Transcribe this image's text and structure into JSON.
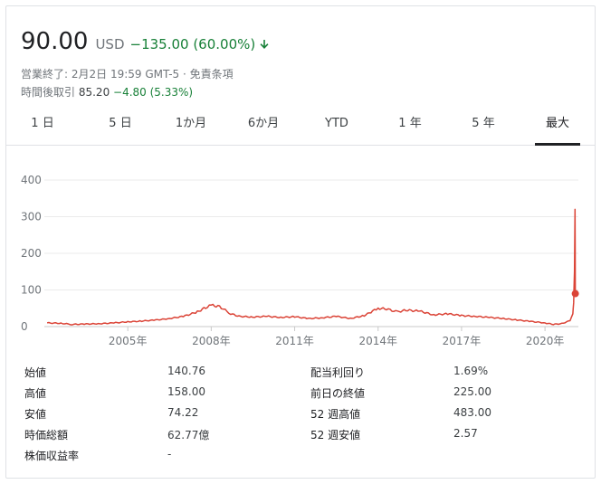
{
  "quote": {
    "price": "90.00",
    "currency": "USD",
    "change": "−135.00 (60.00%)",
    "status_line": "営業終了: 2月2日 19:59 GMT-5 · 免責条項",
    "after_hours_label": "時間後取引",
    "after_hours_price": "85.20",
    "after_hours_change": "−4.80 (5.33%)"
  },
  "tabs": [
    "1 日",
    "5 日",
    "1か月",
    "6か月",
    "YTD",
    "1 年",
    "5 年",
    "最大"
  ],
  "active_tab": "最大",
  "colors": {
    "line": "#db4437",
    "positive": "#188038",
    "grid": "#ebebeb"
  },
  "icons": {
    "change_arrow": "arrow-down-icon"
  },
  "chart_data": {
    "type": "line",
    "ylim": [
      0,
      400
    ],
    "yticks": [
      "0",
      "100",
      "200",
      "300",
      "400"
    ],
    "xticks": [
      "2005年",
      "2008年",
      "2011年",
      "2014年",
      "2017年",
      "2020年"
    ],
    "series": [
      {
        "x": [
          2002.1,
          2002.6,
          2003.0,
          2003.5,
          2004.0,
          2004.5,
          2005.0,
          2005.5,
          2006.0,
          2006.5,
          2007.0,
          2007.5,
          2007.8,
          2008.0,
          2008.3,
          2008.7,
          2009.0,
          2009.5,
          2010.0,
          2010.5,
          2011.0,
          2011.5,
          2012.0,
          2012.5,
          2013.0,
          2013.5,
          2013.8,
          2014.0,
          2014.3,
          2014.7,
          2015.0,
          2015.5,
          2016.0,
          2016.5,
          2017.0,
          2017.5,
          2018.0,
          2018.5,
          2019.0,
          2019.5,
          2020.0,
          2020.3,
          2020.6,
          2020.9,
          2021.0,
          2021.03,
          2021.06,
          2021.08,
          2021.09
        ],
        "values": [
          10,
          9,
          6,
          7,
          8,
          10,
          13,
          15,
          18,
          22,
          28,
          40,
          52,
          58,
          55,
          35,
          28,
          26,
          28,
          25,
          27,
          22,
          24,
          28,
          22,
          30,
          42,
          50,
          48,
          40,
          45,
          42,
          32,
          35,
          30,
          28,
          25,
          22,
          18,
          14,
          10,
          6,
          8,
          16,
          35,
          65,
          150,
          320,
          90
        ]
      }
    ]
  },
  "stats": [
    {
      "label": "始値",
      "value": "140.76"
    },
    {
      "label": "高値",
      "value": "158.00"
    },
    {
      "label": "安値",
      "value": "74.22"
    },
    {
      "label": "時価総額",
      "value": "62.77億"
    },
    {
      "label": "株価収益率",
      "value": "-"
    },
    {
      "label": "配当利回り",
      "value": "1.69%"
    },
    {
      "label": "前日の終値",
      "value": "225.00"
    },
    {
      "label": "52 週高値",
      "value": "483.00"
    },
    {
      "label": "52 週安値",
      "value": "2.57"
    }
  ]
}
